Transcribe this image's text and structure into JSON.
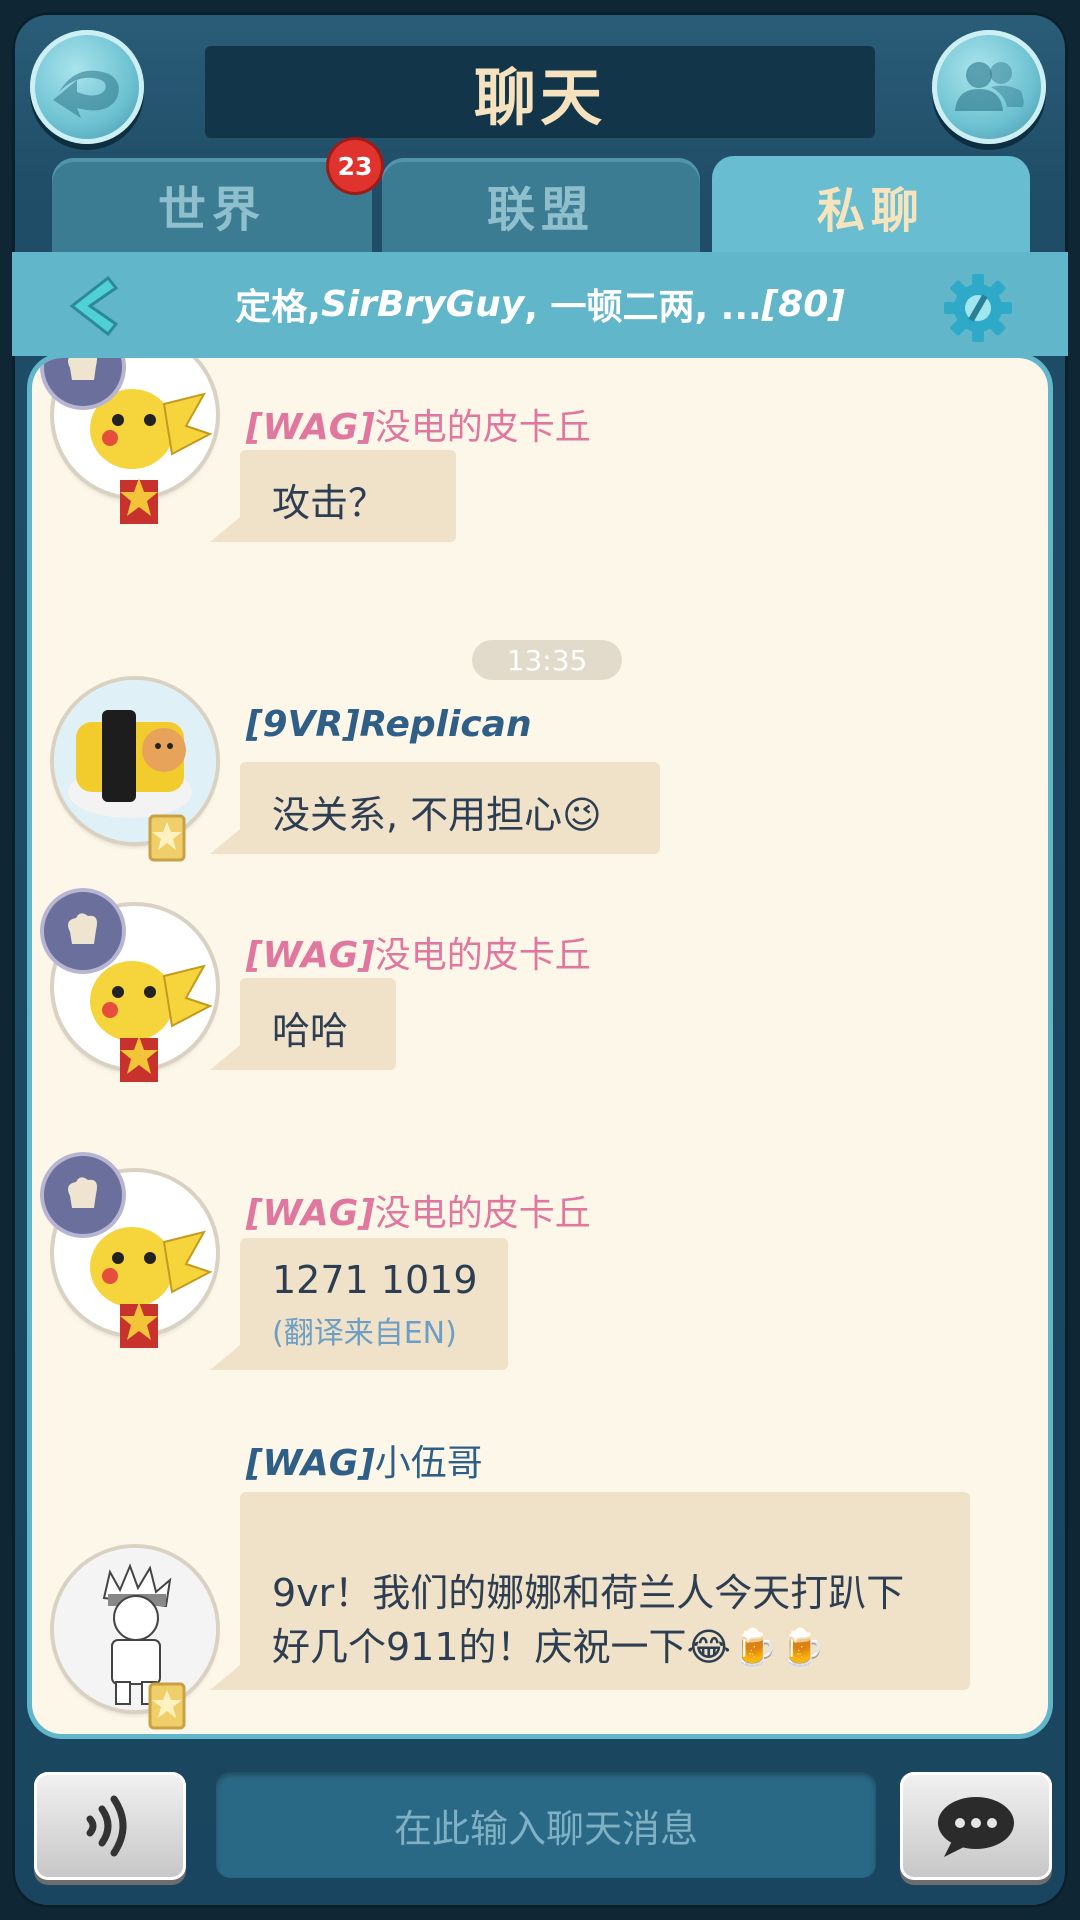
{
  "header": {
    "title": "聊天",
    "back_icon": "back-arrow-icon",
    "friends_icon": "friends-icon"
  },
  "tabs": [
    {
      "label": "世界",
      "badge": "23",
      "active": false
    },
    {
      "label": "联盟",
      "active": false
    },
    {
      "label": "私聊",
      "active": true
    }
  ],
  "conversation": {
    "title_part1": "定格, ",
    "title_part2": "SirBryGuy",
    "title_part3": ", 一顿二两, ...",
    "title_part4": "[80]"
  },
  "messages": [
    {
      "tag": "[WAG]",
      "name": "没电的皮卡丘",
      "text": "攻击？"
    },
    {
      "tag": "[9VR]",
      "name": "Replican",
      "text": "没关系, 不用担心😉"
    },
    {
      "tag": "[WAG]",
      "name": "没电的皮卡丘",
      "text": "哈哈"
    },
    {
      "tag": "[WAG]",
      "name": "没电的皮卡丘",
      "text": "1271 1019",
      "translation": "(翻译来自EN)"
    },
    {
      "tag": "[WAG]",
      "name": "小伍哥",
      "line1": "9vr！我们的娜娜和荷兰人今天打趴下",
      "line2": "好几个911的！庆祝一下😂🍺🍺"
    }
  ],
  "timestamp": "13:35",
  "input": {
    "placeholder": "在此输入聊天消息"
  },
  "colors": {
    "pink_name": "#e0779f",
    "blue_name": "#2f5e86",
    "bubble": "#efe2c8",
    "panel": "#fdf7ea",
    "accent": "#61b6ca"
  }
}
